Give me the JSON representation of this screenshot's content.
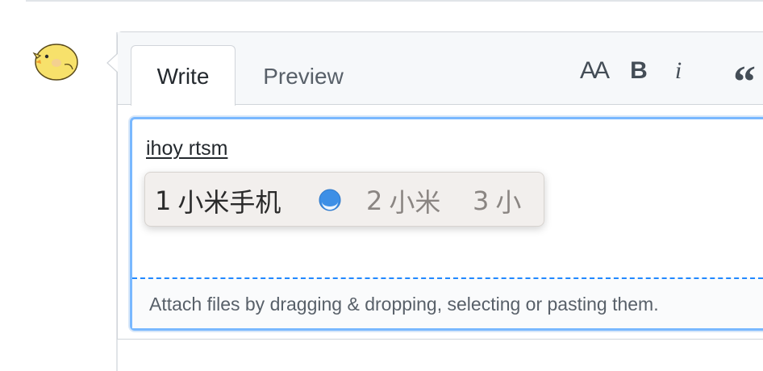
{
  "tabs": {
    "write_label": "Write",
    "preview_label": "Preview"
  },
  "toolbar": {
    "heading_label": "AA",
    "bold_label": "B",
    "italic_label": "i",
    "quote_label": "“"
  },
  "editor": {
    "composition_text": "ihoy rtsm"
  },
  "ime": {
    "candidates": [
      {
        "number": "1",
        "text": "小米手机",
        "selected": true
      },
      {
        "number": "2",
        "text": "小米",
        "selected": false
      },
      {
        "number": "3",
        "text": "小",
        "selected": false
      }
    ]
  },
  "attach": {
    "text": "Attach files by dragging & dropping, selecting or pasting them."
  },
  "colors": {
    "focus_border": "#79b8ff",
    "dashed_border": "#2188ff",
    "avatar_yellow": "#f7e16b"
  },
  "icons": {
    "avatar": "chick-avatar-icon",
    "ime_indicator": "ime-mode-icon"
  }
}
